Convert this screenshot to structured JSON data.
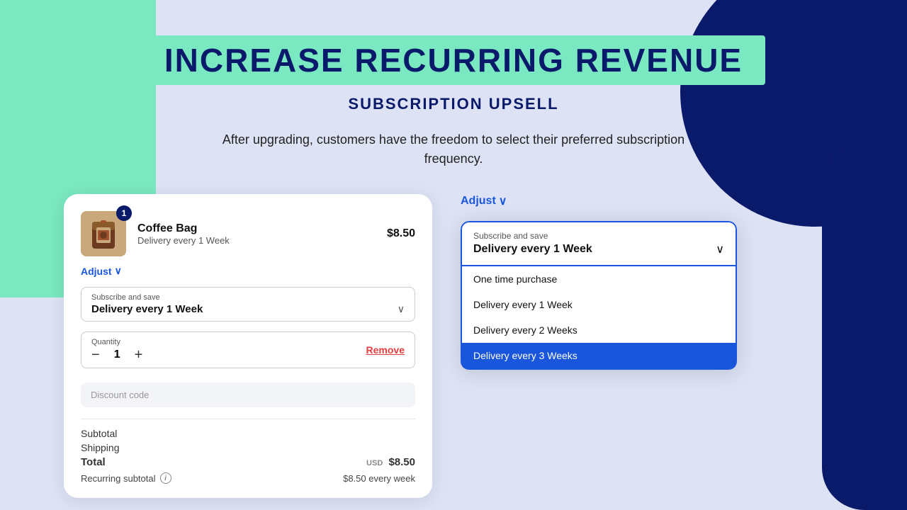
{
  "header": {
    "title": "INCREASE RECURRING REVENUE",
    "subtitle": "SUBSCRIPTION UPSELL",
    "description": "After upgrading, customers have the freedom to select their preferred subscription frequency."
  },
  "left_panel": {
    "item": {
      "name": "Coffee Bag",
      "delivery": "Delivery every 1 Week",
      "price": "$8.50",
      "badge": "1"
    },
    "adjust_label": "Adjust",
    "subscribe_label": "Subscribe and save",
    "subscribe_value": "Delivery every 1 Week",
    "quantity_label": "Quantity",
    "quantity_value": "1",
    "remove_label": "Remove",
    "discount_placeholder": "Discount code",
    "subtotal_label": "Subtotal",
    "shipping_label": "Shipping",
    "total_label": "Total",
    "total_value": "$8.50",
    "usd_label": "USD",
    "recurring_label": "Recurring subtotal",
    "recurring_value": "$8.50 every week"
  },
  "right_panel": {
    "adjust_label": "Adjust",
    "subscribe_label": "Subscribe and save",
    "subscribe_value": "Delivery every 1 Week",
    "options": [
      {
        "label": "One time purchase",
        "selected": false
      },
      {
        "label": "Delivery every 1 Week",
        "selected": false
      },
      {
        "label": "Delivery every 2 Weeks",
        "selected": false
      },
      {
        "label": "Delivery every 3 Weeks",
        "selected": true
      }
    ]
  },
  "icons": {
    "chevron_down": "⌄",
    "info": "i",
    "minus": "−",
    "plus": "+"
  }
}
